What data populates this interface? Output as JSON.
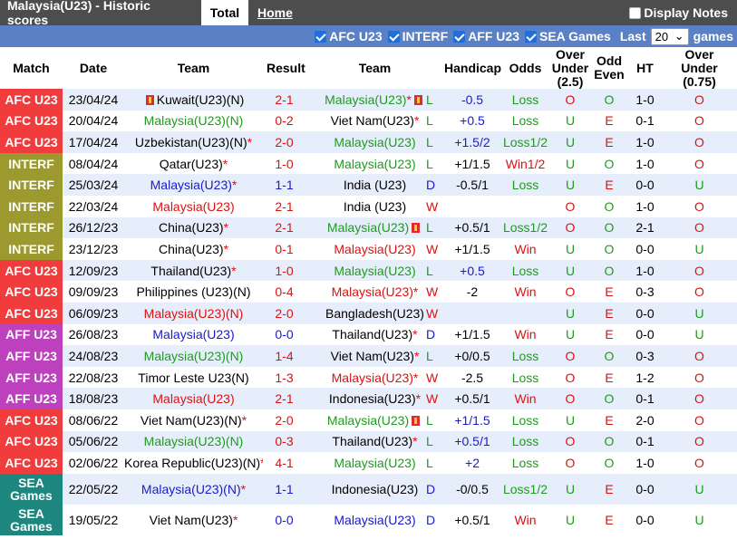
{
  "header": {
    "title": "Malaysia(U23) - Historic scores",
    "tab_total": "Total",
    "tab_home": "Home",
    "display_notes": "Display Notes"
  },
  "filters": {
    "items": [
      "AFC U23",
      "INTERF",
      "AFF U23",
      "SEA Games"
    ],
    "last_label": "Last",
    "games_count": "20",
    "games_label": "games"
  },
  "columns": [
    "Match",
    "Date",
    "Team",
    "Result",
    "Team",
    "Handicap",
    "Odds",
    "Over Under (2.5)",
    "Odd Even",
    "HT",
    "Over Under (0.75)"
  ],
  "colors": {
    "afc_u23": "#f03c3c",
    "interf": "#9c9a2e",
    "aff_u23": "#bd41bd",
    "sea_games": "#1d867e",
    "win": "#dd1111",
    "draw": "#1a1acc",
    "loss": "#1e9b1e"
  },
  "rows": [
    {
      "comp": "AFC U23",
      "cc": "afc_u23",
      "date": "23/04/24",
      "home": "Kuwait(U23)(N)",
      "hc": "black",
      "hflag": true,
      "hstar": false,
      "res": "2-1",
      "rc": "red",
      "away": "Malaysia(U23)",
      "ac": "green",
      "astar": true,
      "aflag": true,
      "wl": "L",
      "wlc": "green",
      "hcp": "-0.5",
      "hcpc": "blue",
      "odds": "Loss",
      "oc": "green",
      "ou": "O",
      "ouc": "red",
      "oe": "O",
      "oec": "green",
      "ht": "1-0",
      "ou2": "O",
      "ou2c": "red"
    },
    {
      "comp": "AFC U23",
      "cc": "afc_u23",
      "date": "20/04/24",
      "home": "Malaysia(U23)(N)",
      "hc": "green",
      "hflag": false,
      "hstar": false,
      "res": "0-2",
      "rc": "red",
      "away": "Viet Nam(U23)",
      "ac": "black",
      "astar": true,
      "aflag": false,
      "wl": "L",
      "wlc": "green",
      "hcp": "+0.5",
      "hcpc": "blue",
      "odds": "Loss",
      "oc": "green",
      "ou": "U",
      "ouc": "green",
      "oe": "E",
      "oec": "red",
      "ht": "0-1",
      "ou2": "O",
      "ou2c": "red"
    },
    {
      "comp": "AFC U23",
      "cc": "afc_u23",
      "date": "17/04/24",
      "home": "Uzbekistan(U23)(N)",
      "hc": "black",
      "hflag": false,
      "hstar": true,
      "res": "2-0",
      "rc": "red",
      "away": "Malaysia(U23)",
      "ac": "green",
      "astar": false,
      "aflag": false,
      "wl": "L",
      "wlc": "green",
      "hcp": "+1.5/2",
      "hcpc": "blue",
      "odds": "Loss1/2",
      "oc": "green",
      "ou": "U",
      "ouc": "green",
      "oe": "E",
      "oec": "red",
      "ht": "1-0",
      "ou2": "O",
      "ou2c": "red"
    },
    {
      "comp": "INTERF",
      "cc": "interf",
      "date": "08/04/24",
      "home": "Qatar(U23)",
      "hc": "black",
      "hflag": false,
      "hstar": true,
      "res": "1-0",
      "rc": "red",
      "away": "Malaysia(U23)",
      "ac": "green",
      "astar": false,
      "aflag": false,
      "wl": "L",
      "wlc": "green",
      "hcp": "+1/1.5",
      "hcpc": "black",
      "odds": "Win1/2",
      "oc": "red",
      "ou": "U",
      "ouc": "green",
      "oe": "O",
      "oec": "green",
      "ht": "1-0",
      "ou2": "O",
      "ou2c": "red"
    },
    {
      "comp": "INTERF",
      "cc": "interf",
      "date": "25/03/24",
      "home": "Malaysia(U23)",
      "hc": "blue",
      "hflag": false,
      "hstar": true,
      "res": "1-1",
      "rc": "blue",
      "away": "India (U23)",
      "ac": "black",
      "astar": false,
      "aflag": false,
      "wl": "D",
      "wlc": "blue",
      "hcp": "-0.5/1",
      "hcpc": "black",
      "odds": "Loss",
      "oc": "green",
      "ou": "U",
      "ouc": "green",
      "oe": "E",
      "oec": "red",
      "ht": "0-0",
      "ou2": "U",
      "ou2c": "green"
    },
    {
      "comp": "INTERF",
      "cc": "interf",
      "date": "22/03/24",
      "home": "Malaysia(U23)",
      "hc": "red",
      "hflag": false,
      "hstar": false,
      "res": "2-1",
      "rc": "red",
      "away": "India (U23)",
      "ac": "black",
      "astar": false,
      "aflag": false,
      "wl": "W",
      "wlc": "red",
      "hcp": "",
      "hcpc": "black",
      "odds": "",
      "oc": "black",
      "ou": "O",
      "ouc": "red",
      "oe": "O",
      "oec": "green",
      "ht": "1-0",
      "ou2": "O",
      "ou2c": "red"
    },
    {
      "comp": "INTERF",
      "cc": "interf",
      "date": "26/12/23",
      "home": "China(U23)",
      "hc": "black",
      "hflag": false,
      "hstar": true,
      "res": "2-1",
      "rc": "red",
      "away": "Malaysia(U23)",
      "ac": "green",
      "astar": false,
      "aflag": true,
      "wl": "L",
      "wlc": "green",
      "hcp": "+0.5/1",
      "hcpc": "black",
      "odds": "Loss1/2",
      "oc": "green",
      "ou": "O",
      "ouc": "red",
      "oe": "O",
      "oec": "green",
      "ht": "2-1",
      "ou2": "O",
      "ou2c": "red"
    },
    {
      "comp": "INTERF",
      "cc": "interf",
      "date": "23/12/23",
      "home": "China(U23)",
      "hc": "black",
      "hflag": false,
      "hstar": true,
      "res": "0-1",
      "rc": "red",
      "away": "Malaysia(U23)",
      "ac": "red",
      "astar": false,
      "aflag": false,
      "wl": "W",
      "wlc": "red",
      "hcp": "+1/1.5",
      "hcpc": "black",
      "odds": "Win",
      "oc": "red",
      "ou": "U",
      "ouc": "green",
      "oe": "O",
      "oec": "green",
      "ht": "0-0",
      "ou2": "U",
      "ou2c": "green"
    },
    {
      "comp": "AFC U23",
      "cc": "afc_u23",
      "date": "12/09/23",
      "home": "Thailand(U23)",
      "hc": "black",
      "hflag": false,
      "hstar": true,
      "res": "1-0",
      "rc": "red",
      "away": "Malaysia(U23)",
      "ac": "green",
      "astar": false,
      "aflag": false,
      "wl": "L",
      "wlc": "green",
      "hcp": "+0.5",
      "hcpc": "blue",
      "odds": "Loss",
      "oc": "green",
      "ou": "U",
      "ouc": "green",
      "oe": "O",
      "oec": "green",
      "ht": "1-0",
      "ou2": "O",
      "ou2c": "red"
    },
    {
      "comp": "AFC U23",
      "cc": "afc_u23",
      "date": "09/09/23",
      "home": "Philippines (U23)(N)",
      "hc": "black",
      "hflag": false,
      "hstar": false,
      "res": "0-4",
      "rc": "red",
      "away": "Malaysia(U23)",
      "ac": "red",
      "astar": true,
      "aflag": false,
      "wl": "W",
      "wlc": "red",
      "hcp": "-2",
      "hcpc": "black",
      "odds": "Win",
      "oc": "red",
      "ou": "O",
      "ouc": "red",
      "oe": "E",
      "oec": "red",
      "ht": "0-3",
      "ou2": "O",
      "ou2c": "red"
    },
    {
      "comp": "AFC U23",
      "cc": "afc_u23",
      "date": "06/09/23",
      "home": "Malaysia(U23)(N)",
      "hc": "red",
      "hflag": false,
      "hstar": false,
      "res": "2-0",
      "rc": "red",
      "away": "Bangladesh(U23)",
      "ac": "black",
      "astar": false,
      "aflag": false,
      "wl": "W",
      "wlc": "red",
      "hcp": "",
      "hcpc": "black",
      "odds": "",
      "oc": "black",
      "ou": "U",
      "ouc": "green",
      "oe": "E",
      "oec": "red",
      "ht": "0-0",
      "ou2": "U",
      "ou2c": "green"
    },
    {
      "comp": "AFF U23",
      "cc": "aff_u23",
      "date": "26/08/23",
      "home": "Malaysia(U23)",
      "hc": "blue",
      "hflag": false,
      "hstar": false,
      "res": "0-0",
      "rc": "blue",
      "away": "Thailand(U23)",
      "ac": "black",
      "astar": true,
      "aflag": false,
      "wl": "D",
      "wlc": "blue",
      "hcp": "+1/1.5",
      "hcpc": "black",
      "odds": "Win",
      "oc": "red",
      "ou": "U",
      "ouc": "green",
      "oe": "E",
      "oec": "red",
      "ht": "0-0",
      "ou2": "U",
      "ou2c": "green"
    },
    {
      "comp": "AFF U23",
      "cc": "aff_u23",
      "date": "24/08/23",
      "home": "Malaysia(U23)(N)",
      "hc": "green",
      "hflag": false,
      "hstar": false,
      "res": "1-4",
      "rc": "red",
      "away": "Viet Nam(U23)",
      "ac": "black",
      "astar": true,
      "aflag": false,
      "wl": "L",
      "wlc": "green",
      "hcp": "+0/0.5",
      "hcpc": "black",
      "odds": "Loss",
      "oc": "green",
      "ou": "O",
      "ouc": "red",
      "oe": "O",
      "oec": "green",
      "ht": "0-3",
      "ou2": "O",
      "ou2c": "red"
    },
    {
      "comp": "AFF U23",
      "cc": "aff_u23",
      "date": "22/08/23",
      "home": "Timor Leste U23(N)",
      "hc": "black",
      "hflag": false,
      "hstar": false,
      "res": "1-3",
      "rc": "red",
      "away": "Malaysia(U23)",
      "ac": "red",
      "astar": true,
      "aflag": false,
      "wl": "W",
      "wlc": "red",
      "hcp": "-2.5",
      "hcpc": "black",
      "odds": "Loss",
      "oc": "green",
      "ou": "O",
      "ouc": "red",
      "oe": "E",
      "oec": "red",
      "ht": "1-2",
      "ou2": "O",
      "ou2c": "red"
    },
    {
      "comp": "AFF U23",
      "cc": "aff_u23",
      "date": "18/08/23",
      "home": "Malaysia(U23)",
      "hc": "red",
      "hflag": false,
      "hstar": false,
      "res": "2-1",
      "rc": "red",
      "away": "Indonesia(U23)",
      "ac": "black",
      "astar": true,
      "aflag": false,
      "wl": "W",
      "wlc": "red",
      "hcp": "+0.5/1",
      "hcpc": "black",
      "odds": "Win",
      "oc": "red",
      "ou": "O",
      "ouc": "red",
      "oe": "O",
      "oec": "green",
      "ht": "0-1",
      "ou2": "O",
      "ou2c": "red"
    },
    {
      "comp": "AFC U23",
      "cc": "afc_u23",
      "date": "08/06/22",
      "home": "Viet Nam(U23)(N)",
      "hc": "black",
      "hflag": false,
      "hstar": true,
      "res": "2-0",
      "rc": "red",
      "away": "Malaysia(U23)",
      "ac": "green",
      "astar": false,
      "aflag": true,
      "wl": "L",
      "wlc": "green",
      "hcp": "+1/1.5",
      "hcpc": "blue",
      "odds": "Loss",
      "oc": "green",
      "ou": "U",
      "ouc": "green",
      "oe": "E",
      "oec": "red",
      "ht": "2-0",
      "ou2": "O",
      "ou2c": "red"
    },
    {
      "comp": "AFC U23",
      "cc": "afc_u23",
      "date": "05/06/22",
      "home": "Malaysia(U23)(N)",
      "hc": "green",
      "hflag": false,
      "hstar": false,
      "res": "0-3",
      "rc": "red",
      "away": "Thailand(U23)",
      "ac": "black",
      "astar": true,
      "aflag": false,
      "wl": "L",
      "wlc": "green",
      "hcp": "+0.5/1",
      "hcpc": "blue",
      "odds": "Loss",
      "oc": "green",
      "ou": "O",
      "ouc": "red",
      "oe": "O",
      "oec": "green",
      "ht": "0-1",
      "ou2": "O",
      "ou2c": "red"
    },
    {
      "comp": "AFC U23",
      "cc": "afc_u23",
      "date": "02/06/22",
      "home": "Korea Republic(U23)(N)",
      "hc": "black",
      "hflag": false,
      "hstar": true,
      "res": "4-1",
      "rc": "red",
      "away": "Malaysia(U23)",
      "ac": "green",
      "astar": false,
      "aflag": false,
      "wl": "L",
      "wlc": "green",
      "hcp": "+2",
      "hcpc": "blue",
      "odds": "Loss",
      "oc": "green",
      "ou": "O",
      "ouc": "red",
      "oe": "O",
      "oec": "green",
      "ht": "1-0",
      "ou2": "O",
      "ou2c": "red"
    },
    {
      "comp": "SEA Games",
      "cc": "sea_games",
      "date": "22/05/22",
      "home": "Malaysia(U23)(N)",
      "hc": "blue",
      "hflag": false,
      "hstar": true,
      "res": "1-1",
      "rc": "blue",
      "away": "Indonesia(U23)",
      "ac": "black",
      "astar": false,
      "aflag": false,
      "wl": "D",
      "wlc": "blue",
      "hcp": "-0/0.5",
      "hcpc": "black",
      "odds": "Loss1/2",
      "oc": "green",
      "ou": "U",
      "ouc": "green",
      "oe": "E",
      "oec": "red",
      "ht": "0-0",
      "ou2": "U",
      "ou2c": "green"
    },
    {
      "comp": "SEA Games",
      "cc": "sea_games",
      "date": "19/05/22",
      "home": "Viet Nam(U23)",
      "hc": "black",
      "hflag": false,
      "hstar": true,
      "res": "0-0",
      "rc": "blue",
      "away": "Malaysia(U23)",
      "ac": "blue",
      "astar": false,
      "aflag": false,
      "wl": "D",
      "wlc": "blue",
      "hcp": "+0.5/1",
      "hcpc": "black",
      "odds": "Win",
      "oc": "red",
      "ou": "U",
      "ouc": "green",
      "oe": "E",
      "oec": "red",
      "ht": "0-0",
      "ou2": "U",
      "ou2c": "green"
    }
  ]
}
